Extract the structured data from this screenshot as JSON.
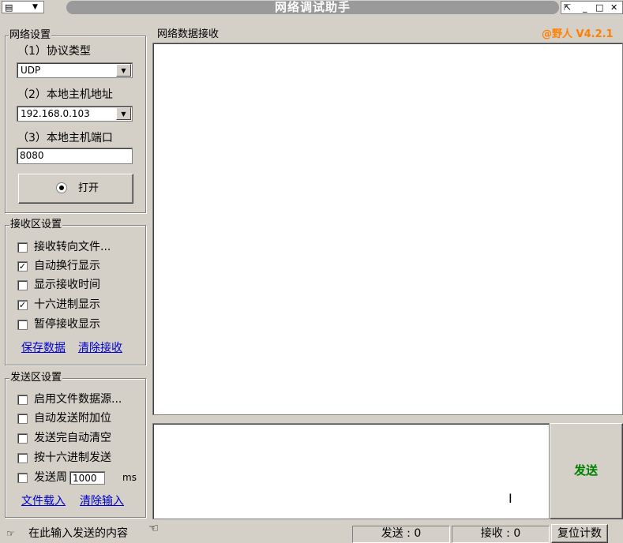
{
  "window": {
    "title": "网络调试助手"
  },
  "network_settings": {
    "group_title": "网络设置",
    "protocol_label": "（1）协议类型",
    "protocol_value": "UDP",
    "host_label": "（2）本地主机地址",
    "host_value": "192.168.0.103",
    "port_label": "（3）本地主机端口",
    "port_value": "8080",
    "open_button": "打开"
  },
  "receive_settings": {
    "group_title": "接收区设置",
    "options": [
      {
        "label": "接收转向文件...",
        "checked": false
      },
      {
        "label": "自动换行显示",
        "checked": true
      },
      {
        "label": "显示接收时间",
        "checked": false
      },
      {
        "label": "十六进制显示",
        "checked": true
      },
      {
        "label": "暂停接收显示",
        "checked": false
      }
    ],
    "save_link": "保存数据",
    "clear_link": "清除接收"
  },
  "send_settings": {
    "group_title": "发送区设置",
    "options": [
      {
        "label": "启用文件数据源...",
        "checked": false
      },
      {
        "label": "自动发送附加位",
        "checked": false
      },
      {
        "label": "发送完自动清空",
        "checked": false
      },
      {
        "label": "按十六进制发送",
        "checked": false
      },
      {
        "label": "发送周",
        "checked": false
      }
    ],
    "period_value": "1000",
    "period_unit": "ms",
    "load_link": "文件载入",
    "clear_link": "清除输入"
  },
  "receive_area": {
    "title": "网络数据接收",
    "brand": "@野人 V4.2.1"
  },
  "send_button": "发送",
  "status": {
    "hint": "在此输入发送的内容",
    "sent": "发送 : 0",
    "received": "接收 : 0",
    "reset_button": "复位计数"
  },
  "colors": {
    "brand": "#ff7f00",
    "send_button_text": "#008000",
    "link": "#0000cc"
  }
}
